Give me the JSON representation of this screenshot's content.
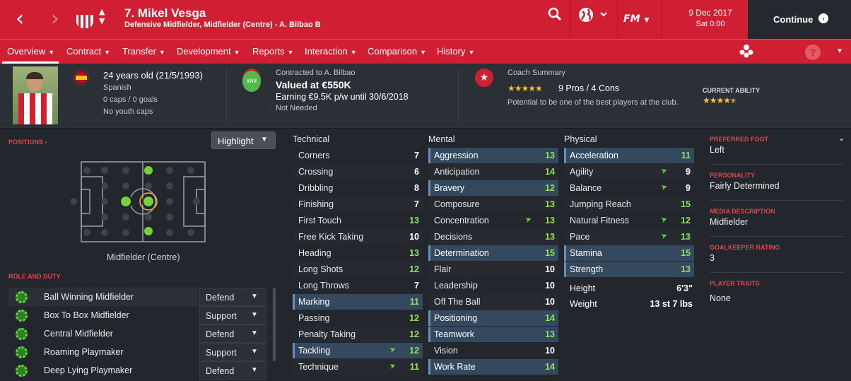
{
  "header": {
    "back_icon": "chevron-left",
    "forward_icon": "chevron-right",
    "player_title": "7. Mikel Vesga",
    "player_subtitle": "Defensive Midfielder, Midfielder (Centre) - A. Bilbao B",
    "date": "9 Dec 2017",
    "time": "Sat 0:00",
    "continue_label": "Continue",
    "fm_label": "FM"
  },
  "tabs": [
    {
      "label": "Overview"
    },
    {
      "label": "Contract"
    },
    {
      "label": "Transfer"
    },
    {
      "label": "Development"
    },
    {
      "label": "Reports"
    },
    {
      "label": "Interaction"
    },
    {
      "label": "Comparison"
    },
    {
      "label": "History"
    }
  ],
  "help_label": "?",
  "summary": {
    "age": "24 years old (21/5/1993)",
    "nationality": "Spanish",
    "caps": "0 caps / 0 goals",
    "youth_caps": "No youth caps",
    "contract_label": "Contracted to A. Bilbao",
    "value": "Valued at €550K",
    "earning": "Earning €9.5K p/w until 30/6/2018",
    "status": "Not Needed",
    "wanted_badge": "Wnt",
    "coach_title": "Coach Summary",
    "pros_cons": "9 Pros / 4 Cons",
    "coach_stars": "★★★★★",
    "potential": "Potential to be one of the best players at the club.",
    "ca_label": "CURRENT ABILITY",
    "ca_stars": "★★★★★",
    "ca_rating": 4.5
  },
  "positions": {
    "title": "POSITIONS",
    "title_arrow": "›",
    "highlight_label": "Highlight",
    "position_name": "Midfielder (Centre)"
  },
  "roles": {
    "title": "ROLE AND DUTY",
    "items": [
      {
        "role": "Ball Winning Midfielder",
        "duty": "Defend"
      },
      {
        "role": "Box To Box Midfielder",
        "duty": "Support"
      },
      {
        "role": "Central Midfielder",
        "duty": "Defend"
      },
      {
        "role": "Roaming Playmaker",
        "duty": "Support"
      },
      {
        "role": "Deep Lying Playmaker",
        "duty": "Defend"
      }
    ]
  },
  "attributes": {
    "technical_title": "Technical",
    "mental_title": "Mental",
    "physical_title": "Physical",
    "technical": [
      {
        "name": "Corners",
        "value": "7"
      },
      {
        "name": "Crossing",
        "value": "6"
      },
      {
        "name": "Dribbling",
        "value": "8"
      },
      {
        "name": "Finishing",
        "value": "7"
      },
      {
        "name": "First Touch",
        "value": "13"
      },
      {
        "name": "Free Kick Taking",
        "value": "10"
      },
      {
        "name": "Heading",
        "value": "13"
      },
      {
        "name": "Long Shots",
        "value": "12"
      },
      {
        "name": "Long Throws",
        "value": "7"
      },
      {
        "name": "Marking",
        "value": "11",
        "hl": true
      },
      {
        "name": "Passing",
        "value": "12"
      },
      {
        "name": "Penalty Taking",
        "value": "12"
      },
      {
        "name": "Tackling",
        "value": "12",
        "hl": true,
        "trend": true
      },
      {
        "name": "Technique",
        "value": "11",
        "trend": true
      }
    ],
    "mental": [
      {
        "name": "Aggression",
        "value": "13",
        "hl": true
      },
      {
        "name": "Anticipation",
        "value": "14"
      },
      {
        "name": "Bravery",
        "value": "12",
        "hl": true
      },
      {
        "name": "Composure",
        "value": "13"
      },
      {
        "name": "Concentration",
        "value": "13",
        "trend": true
      },
      {
        "name": "Decisions",
        "value": "13"
      },
      {
        "name": "Determination",
        "value": "15",
        "hl": true
      },
      {
        "name": "Flair",
        "value": "10"
      },
      {
        "name": "Leadership",
        "value": "10"
      },
      {
        "name": "Off The Ball",
        "value": "10"
      },
      {
        "name": "Positioning",
        "value": "14",
        "hl": true
      },
      {
        "name": "Teamwork",
        "value": "13",
        "hl": true
      },
      {
        "name": "Vision",
        "value": "10"
      },
      {
        "name": "Work Rate",
        "value": "14",
        "hl": true
      }
    ],
    "physical": [
      {
        "name": "Acceleration",
        "value": "11",
        "hl": true
      },
      {
        "name": "Agility",
        "value": "9",
        "trend": true
      },
      {
        "name": "Balance",
        "value": "9",
        "trend": true
      },
      {
        "name": "Jumping Reach",
        "value": "15"
      },
      {
        "name": "Natural Fitness",
        "value": "12",
        "trend": true
      },
      {
        "name": "Pace",
        "value": "13",
        "trend": true
      },
      {
        "name": "Stamina",
        "value": "15",
        "hl": true
      },
      {
        "name": "Strength",
        "value": "13",
        "hl": true
      }
    ],
    "height_label": "Height",
    "height": "6'3\"",
    "weight_label": "Weight",
    "weight": "13 st 7 lbs"
  },
  "info": {
    "foot_title": "PREFERRED FOOT",
    "foot": "Left",
    "personality_title": "PERSONALITY",
    "personality": "Fairly Determined",
    "media_title": "MEDIA DESCRIPTION",
    "media": "Midfielder",
    "gk_title": "GOALKEEPER RATING",
    "gk": "3",
    "traits_title": "PLAYER TRAITS",
    "traits": "None"
  },
  "colors": {
    "accent": "#d01f33",
    "value_green": "#8fe35e",
    "value_white": "#ffffff",
    "highlight": "#34485e"
  }
}
